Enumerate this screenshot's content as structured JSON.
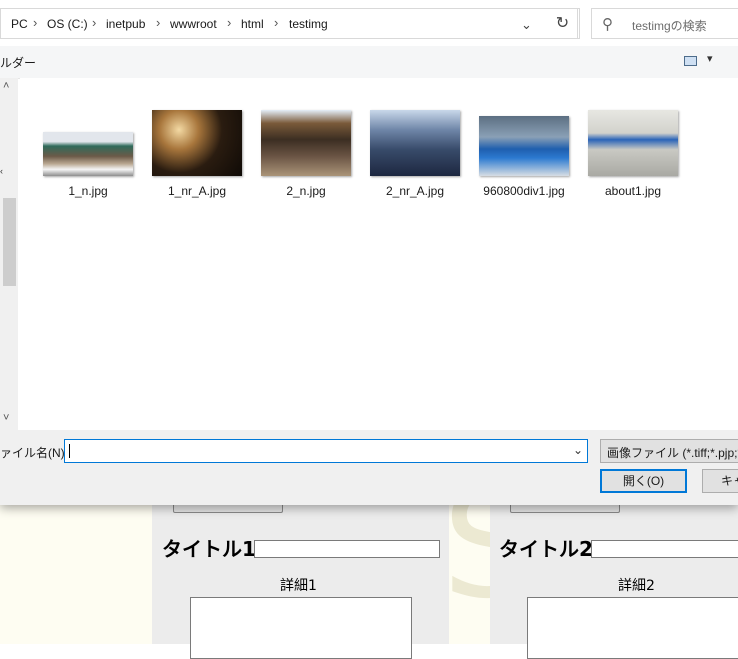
{
  "address": {
    "crumbs": [
      "PC",
      "OS (C:)",
      "inetpub",
      "wwwroot",
      "html",
      "testimg"
    ],
    "separator": "›",
    "dropdown_glyph": "⌄",
    "refresh_glyph": "↻"
  },
  "search": {
    "placeholder": "testimgの検索",
    "icon": "search-icon"
  },
  "toolbar": {
    "label": "ルダー",
    "view_icon": "view-options-icon",
    "view_dropdown": "▾"
  },
  "navpane": {
    "up": "˄",
    "down": "˅",
    "mark": "‹"
  },
  "files": [
    {
      "name": "1_n.jpg"
    },
    {
      "name": "1_nr_A.jpg"
    },
    {
      "name": "2_n.jpg"
    },
    {
      "name": "2_nr_A.jpg"
    },
    {
      "name": "960800div1.jpg"
    },
    {
      "name": "about1.jpg"
    }
  ],
  "bottom": {
    "filename_label": "ァイル名(N):",
    "filename_value": "",
    "filename_dropdown": "⌄",
    "filetype_value": "画像ファイル (*.tiff;*.pjp;*.jfif",
    "open_label": "開く(O)",
    "cancel_label": "キャンセル"
  },
  "background_page": {
    "card1": {
      "title": "タイトル1",
      "detail_label": "詳細1"
    },
    "card2": {
      "title": "タイトル2",
      "detail_label": "詳細2"
    },
    "watermark": "S"
  },
  "colors": {
    "accent": "#0078d7",
    "page_bg": "#fefdf2",
    "card_bg": "#ececec"
  }
}
